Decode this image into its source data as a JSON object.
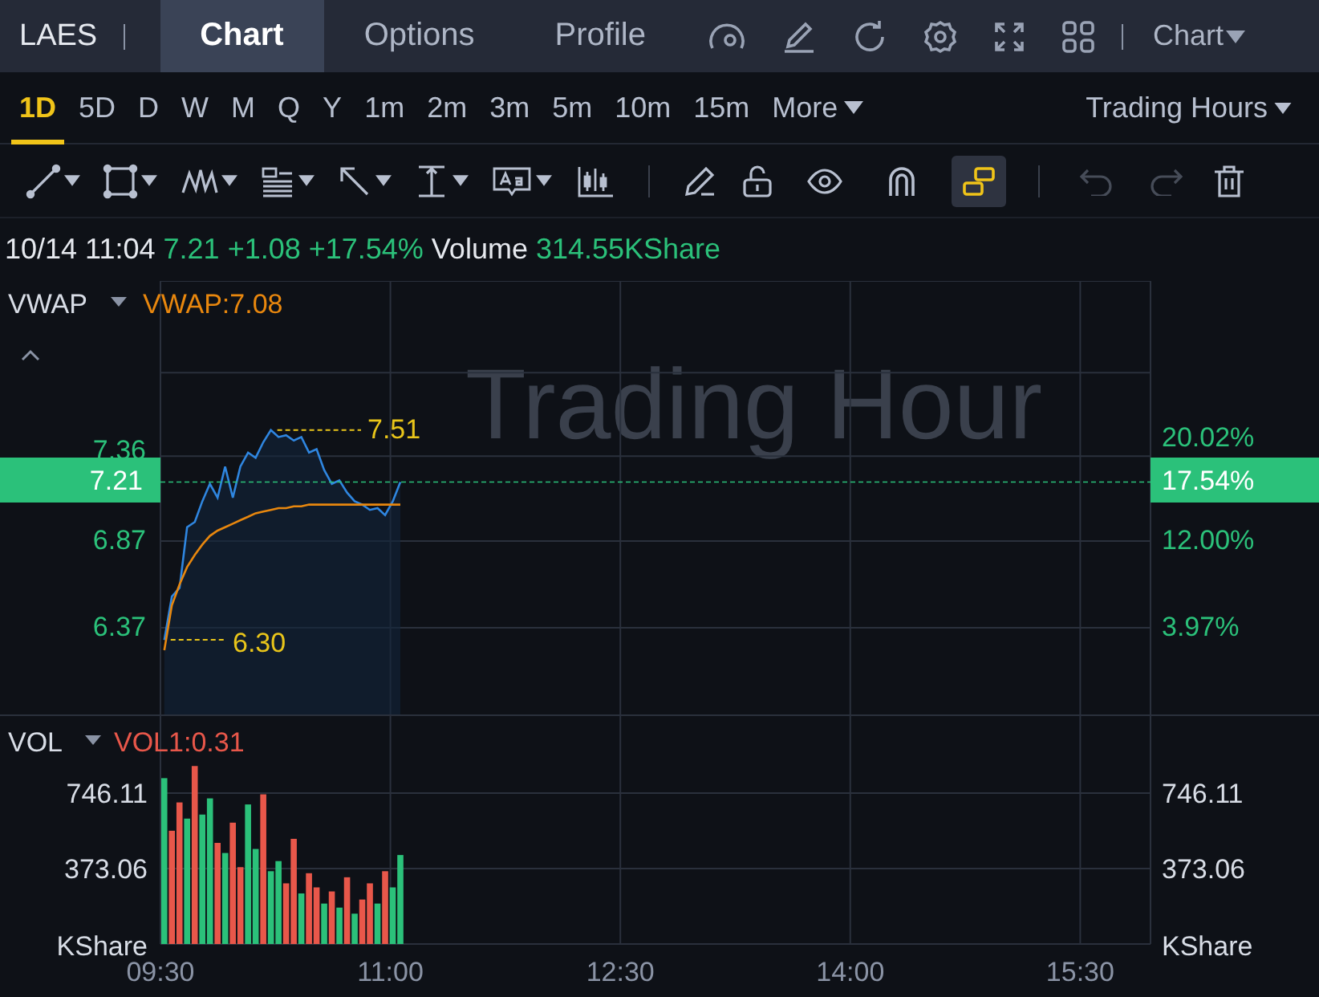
{
  "top_bar": {
    "symbol": "LAES",
    "tabs": [
      {
        "label": "Chart",
        "selected": true
      },
      {
        "label": "Options",
        "selected": false
      },
      {
        "label": "Profile",
        "selected": false
      }
    ],
    "menu": "Chart"
  },
  "timeframes": [
    {
      "label": "1D",
      "selected": true
    },
    {
      "label": "5D",
      "selected": false
    },
    {
      "label": "D",
      "selected": false
    },
    {
      "label": "W",
      "selected": false
    },
    {
      "label": "M",
      "selected": false
    },
    {
      "label": "Q",
      "selected": false
    },
    {
      "label": "Y",
      "selected": false
    },
    {
      "label": "1m",
      "selected": false
    },
    {
      "label": "2m",
      "selected": false
    },
    {
      "label": "3m",
      "selected": false
    },
    {
      "label": "5m",
      "selected": false
    },
    {
      "label": "10m",
      "selected": false
    },
    {
      "label": "15m",
      "selected": false
    }
  ],
  "more": "More",
  "session": "Trading Hours",
  "toolbar": {
    "toggles": [
      {
        "selected": false
      },
      {
        "selected": false
      },
      {
        "selected": true
      }
    ],
    "history": [
      {
        "disabled": true
      },
      {
        "disabled": true
      }
    ]
  },
  "quote": {
    "time": "10/14 11:04",
    "price": "7.21",
    "change": "+1.08",
    "percent": "+17.54%",
    "volume_label": "Volume",
    "volume": "314.55KShare"
  },
  "price_panel": {
    "indicator": "VWAP",
    "indicator_value": "VWAP:7.08",
    "watermark": "Trading Hour",
    "last_price": "7.21",
    "last_percent": "17.54%",
    "right_labels": [
      "20.02%",
      "12.00%",
      "3.97%"
    ],
    "chart_data": {
      "type": "line",
      "grid": true,
      "categories": [
        null,
        null,
        null,
        null,
        null,
        null,
        null,
        null,
        null,
        null,
        null,
        null,
        null,
        null,
        null,
        null,
        null,
        null,
        null,
        null,
        null,
        null,
        null,
        null,
        null,
        null,
        null,
        null,
        null,
        null,
        null,
        null,
        null,
        null,
        null,
        null,
        null,
        null,
        null,
        null,
        null,
        null,
        null,
        null,
        null,
        null,
        null,
        null,
        null,
        null,
        null,
        null,
        null,
        null,
        null,
        null,
        null,
        null,
        null,
        null,
        null,
        null,
        null,
        null,
        null,
        null,
        null,
        null,
        null,
        null,
        null,
        null,
        null,
        null,
        null,
        null,
        null,
        null,
        null,
        null,
        null,
        null,
        null,
        null,
        null,
        null,
        null,
        null,
        null,
        null,
        null,
        null,
        null,
        null,
        null,
        null,
        null,
        null,
        null,
        null,
        null,
        null,
        null,
        null,
        null,
        null,
        null,
        null,
        null,
        null,
        null,
        null,
        null,
        null,
        null,
        null,
        null,
        null,
        null,
        null,
        null,
        null,
        null,
        null,
        null,
        null,
        null,
        null,
        null,
        null
      ],
      "ylim": [
        5.87,
        8.37
      ],
      "yticks": [
        6.37,
        6.87,
        7.36
      ],
      "series": [
        {
          "color": "#2f86e0",
          "values": [
            6.3,
            6.55,
            6.6,
            6.95,
            6.98,
            7.1,
            7.2,
            7.12,
            7.3,
            7.12,
            7.3,
            7.38,
            7.35,
            7.44,
            7.51,
            7.47,
            7.48,
            7.45,
            7.47,
            7.38,
            7.4,
            7.28,
            7.2,
            7.22,
            7.15,
            7.1,
            7.08,
            7.05,
            7.06,
            7.02,
            7.1,
            7.21,
            null,
            null,
            null,
            null,
            null,
            null,
            null,
            null,
            null,
            null,
            null,
            null,
            null,
            null,
            null,
            null,
            null,
            null,
            null,
            null,
            null,
            null,
            null,
            null,
            null,
            null,
            null,
            null,
            null,
            null,
            null,
            null,
            null,
            null,
            null,
            null,
            null,
            null,
            null,
            null,
            null,
            null,
            null,
            null,
            null,
            null,
            null,
            null,
            null,
            null,
            null,
            null,
            null,
            null,
            null,
            null,
            null,
            null,
            null,
            null,
            null,
            null,
            null,
            null,
            null,
            null,
            null,
            null,
            null,
            null,
            null,
            null,
            null,
            null,
            null,
            null,
            null,
            null,
            null,
            null,
            null,
            null,
            null,
            null,
            null,
            null,
            null,
            null,
            null,
            null,
            null,
            null,
            null,
            null,
            null,
            null,
            null,
            null
          ]
        },
        {
          "color": "#e8870e",
          "values": [
            6.24,
            6.5,
            6.62,
            6.72,
            6.79,
            6.85,
            6.9,
            6.93,
            6.95,
            6.97,
            6.99,
            7.01,
            7.03,
            7.04,
            7.05,
            7.06,
            7.06,
            7.07,
            7.07,
            7.08,
            7.08,
            7.08,
            7.08,
            7.08,
            7.08,
            7.08,
            7.08,
            7.08,
            7.08,
            7.08,
            7.08,
            7.08,
            null,
            null,
            null,
            null,
            null,
            null,
            null,
            null,
            null,
            null,
            null,
            null,
            null,
            null,
            null,
            null,
            null,
            null,
            null,
            null,
            null,
            null,
            null,
            null,
            null,
            null,
            null,
            null,
            null,
            null,
            null,
            null,
            null,
            null,
            null,
            null,
            null,
            null,
            null,
            null,
            null,
            null,
            null,
            null,
            null,
            null,
            null,
            null,
            null,
            null,
            null,
            null,
            null,
            null,
            null,
            null,
            null,
            null,
            null,
            null,
            null,
            null,
            null,
            null,
            null,
            null,
            null,
            null,
            null,
            null,
            null,
            null,
            null,
            null,
            null,
            null,
            null,
            null,
            null,
            null,
            null,
            null,
            null,
            null,
            null,
            null,
            null,
            null,
            null,
            null,
            null,
            null,
            null,
            null,
            null,
            null,
            null,
            null
          ]
        }
      ],
      "ref_lines": [
        {
          "axis": "y",
          "value": 7.21
        }
      ],
      "annotations": [
        {
          "text": "7.51"
        },
        {
          "text": "6.30"
        }
      ]
    }
  },
  "volume_panel": {
    "indicator": "VOL",
    "indicator_value": "VOL1:0.31",
    "unit_labels": [
      "KShare",
      "KShare"
    ],
    "right_labels": [
      "746.11",
      "373.06"
    ],
    "time_labels": [
      "09:30",
      "11:00",
      "12:30",
      "14:00",
      "15:30"
    ],
    "chart_data": {
      "type": "bar",
      "stacked": true,
      "grid": true,
      "categories": [
        null,
        null,
        null,
        null,
        null,
        null,
        null,
        null,
        null,
        null,
        null,
        null,
        null,
        null,
        null,
        null,
        null,
        null,
        null,
        null,
        null,
        null,
        null,
        null,
        null,
        null,
        null,
        null,
        null,
        null,
        null,
        null,
        null,
        null,
        null,
        null,
        null,
        null,
        null,
        null,
        null,
        null,
        null,
        null,
        null,
        null,
        null,
        null,
        null,
        null,
        null,
        null,
        null,
        null,
        null,
        null,
        null,
        null,
        null,
        null,
        null,
        null,
        null,
        null,
        null,
        null,
        null,
        null,
        null,
        null,
        null,
        null,
        null,
        null,
        null,
        null,
        null,
        null,
        null,
        null,
        null,
        null,
        null,
        null,
        null,
        null,
        null,
        null,
        null,
        null,
        null,
        null,
        null,
        null,
        null,
        null,
        null,
        null,
        null,
        null,
        null,
        null,
        null,
        null,
        null,
        null,
        null,
        null,
        null,
        null,
        null,
        null,
        null,
        null,
        null,
        null,
        null,
        null,
        null,
        null,
        null,
        null,
        null,
        null,
        null,
        null,
        null,
        null,
        null,
        null
      ],
      "ylim": [
        0,
        1135
      ],
      "yticks": [
        373.06,
        746.11
      ],
      "series": [
        {
          "color": "#2bc17a",
          "values": [
            820,
            null,
            null,
            620,
            null,
            640,
            720,
            null,
            450,
            null,
            null,
            690,
            470,
            null,
            360,
            410,
            null,
            null,
            250,
            null,
            null,
            200,
            null,
            180,
            null,
            150,
            null,
            null,
            200,
            null,
            280,
            440,
            null,
            null,
            null,
            null,
            null,
            null,
            null,
            null,
            null,
            null,
            null,
            null,
            null,
            null,
            null,
            null,
            null,
            null,
            null,
            null,
            null,
            null,
            null,
            null,
            null,
            null,
            null,
            null,
            null,
            null,
            null,
            null,
            null,
            null,
            null,
            null,
            null,
            null,
            null,
            null,
            null,
            null,
            null,
            null,
            null,
            null,
            null,
            null,
            null,
            null,
            null,
            null,
            null,
            null,
            null,
            null,
            null,
            null,
            null,
            null,
            null,
            null,
            null,
            null,
            null,
            null,
            null,
            null,
            null,
            null,
            null,
            null,
            null,
            null,
            null,
            null,
            null,
            null,
            null,
            null,
            null,
            null,
            null,
            null,
            null,
            null,
            null,
            null,
            null,
            null,
            null,
            null,
            null,
            null,
            null,
            null,
            null,
            null
          ]
        },
        {
          "color": "#e8574a",
          "values": [
            null,
            560,
            700,
            null,
            880,
            null,
            null,
            500,
            null,
            600,
            380,
            null,
            null,
            740,
            null,
            null,
            300,
            520,
            null,
            350,
            280,
            null,
            260,
            null,
            330,
            null,
            220,
            300,
            null,
            360,
            null,
            null,
            null,
            null,
            null,
            null,
            null,
            null,
            null,
            null,
            null,
            null,
            null,
            null,
            null,
            null,
            null,
            null,
            null,
            null,
            null,
            null,
            null,
            null,
            null,
            null,
            null,
            null,
            null,
            null,
            null,
            null,
            null,
            null,
            null,
            null,
            null,
            null,
            null,
            null,
            null,
            null,
            null,
            null,
            null,
            null,
            null,
            null,
            null,
            null,
            null,
            null,
            null,
            null,
            null,
            null,
            null,
            null,
            null,
            null,
            null,
            null,
            null,
            null,
            null,
            null,
            null,
            null,
            null,
            null,
            null,
            null,
            null,
            null,
            null,
            null,
            null,
            null,
            null,
            null,
            null,
            null,
            null,
            null,
            null,
            null,
            null,
            null,
            null,
            null,
            null,
            null,
            null,
            null,
            null,
            null,
            null,
            null,
            null,
            null
          ]
        }
      ]
    }
  }
}
